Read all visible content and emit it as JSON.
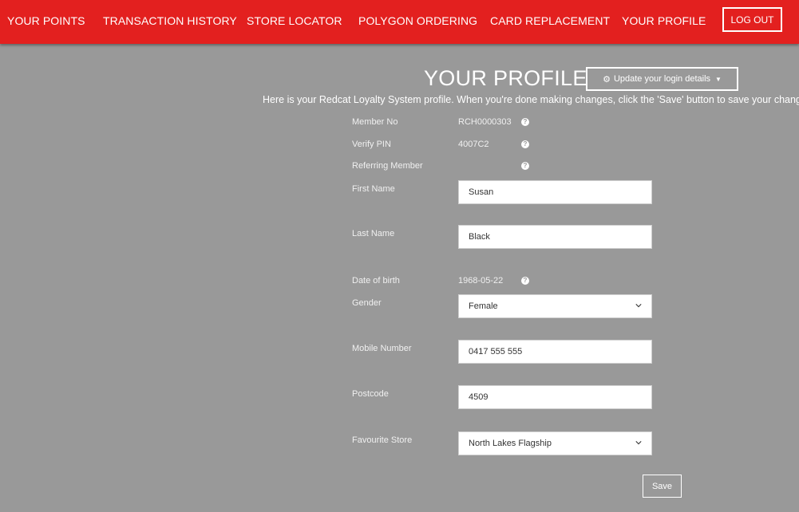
{
  "nav": {
    "items": [
      "YOUR POINTS",
      "TRANSACTION HISTORY",
      "STORE LOCATOR",
      "POLYGON ORDERING",
      "CARD REPLACEMENT",
      "YOUR PROFILE"
    ],
    "logout": "LOG OUT"
  },
  "profile": {
    "title": "YOUR PROFILE",
    "update_button": "Update your login details",
    "intro": "Here is your Redcat Loyalty System profile. When you're done making changes, click the 'Save' button to save your changes.",
    "member_no_label": "Member No",
    "member_no": "RCH0000303",
    "verify_pin_label": "Verify PIN",
    "verify_pin": "4007C2",
    "referring_label": "Referring Member",
    "first_name_label": "First Name",
    "first_name": "Susan",
    "last_name_label": "Last Name",
    "last_name": "Black",
    "dob_label": "Date of birth",
    "dob": "1968-05-22",
    "gender_label": "Gender",
    "gender": "Female",
    "mobile_label": "Mobile Number",
    "mobile": "0417 555 555",
    "postcode_label": "Postcode",
    "postcode": "4509",
    "store_label": "Favourite Store",
    "store": "North Lakes Flagship",
    "save": "Save"
  },
  "colors": {
    "nav_bg": "#e3201f",
    "page_bg": "#999999"
  },
  "icons": [
    "gear-icon",
    "caret-down-icon",
    "help-icon",
    "chevron-down-icon"
  ]
}
